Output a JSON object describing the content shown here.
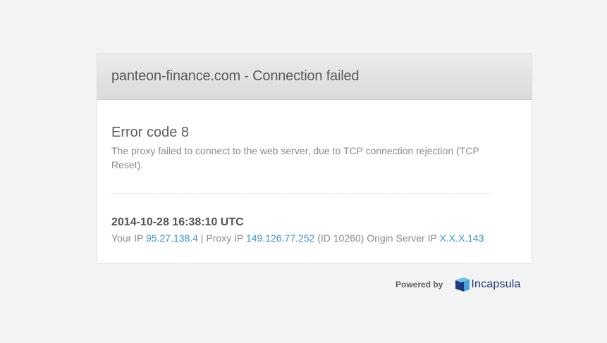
{
  "header": {
    "title": "panteon-finance.com - Connection failed"
  },
  "error": {
    "code_label": "Error code 8",
    "description": "The proxy failed to connect to the web server, due to TCP connection rejection (TCP Reset)."
  },
  "details": {
    "timestamp": "2014-10-28 16:38:10 UTC",
    "your_ip_label": "Your IP",
    "your_ip": "95.27.138.4",
    "proxy_ip_label": "| Proxy IP",
    "proxy_ip": "149.126.77.252",
    "proxy_id": "(ID 10260)",
    "origin_label": "Origin Server IP",
    "origin_ip": "X.X.X.143"
  },
  "footer": {
    "powered_by": "Powered by",
    "logo_text": "Incapsula",
    "logo_icon": "incapsula-logo-icon"
  },
  "colors": {
    "link": "#3a95c9",
    "logo": "#1e3a7a",
    "background": "#f3f3f3"
  }
}
